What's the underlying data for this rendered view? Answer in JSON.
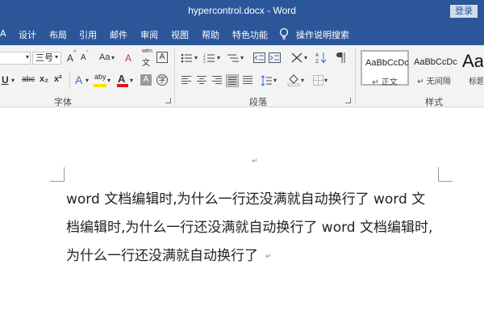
{
  "window": {
    "title": "hypercontrol.docx  -  Word",
    "login_label": "登录"
  },
  "menu": {
    "items": [
      "A",
      "设计",
      "布局",
      "引用",
      "邮件",
      "审阅",
      "视图",
      "帮助",
      "特色功能"
    ],
    "tell_me": "操作说明搜索"
  },
  "ribbon": {
    "font": {
      "size_value": "三号",
      "grow_label": "A",
      "shrink_label": "A",
      "case_label": "Aa",
      "clear_format_label": "A",
      "phonetic_label": "wén",
      "border_label": "A",
      "underline_label": "U",
      "strike_label": "abc",
      "subscript_label": "x₂",
      "superscript_label": "x²",
      "effects_label": "A",
      "highlight_label": "aby",
      "color_label": "A",
      "shading_label": "A",
      "enclose_label": "字",
      "group_label": "字体"
    },
    "paragraph": {
      "group_label": "段落",
      "active_alignment": "justify"
    },
    "styles": {
      "group_label": "样式",
      "items": [
        {
          "sample": "AaBbCcDc",
          "name": "↵ 正文"
        },
        {
          "sample": "AaBbCcDc",
          "name": "↵ 无间隔"
        },
        {
          "sample": "Aa",
          "name": "标题"
        }
      ]
    },
    "colors": {
      "highlight": "#f4e400",
      "font_color": "#e81123",
      "ribbon_bg": "#f3f3f3",
      "title_bg": "#2b579a"
    }
  },
  "document": {
    "lines": [
      "word 文档编辑时,为什么一行还没满就自动换行了 word 文",
      "档编辑时,为什么一行还没满就自动换行了 word 文档编辑时,",
      "为什么一行还没满就自动换行了"
    ],
    "paragraph_mark": "↵"
  }
}
